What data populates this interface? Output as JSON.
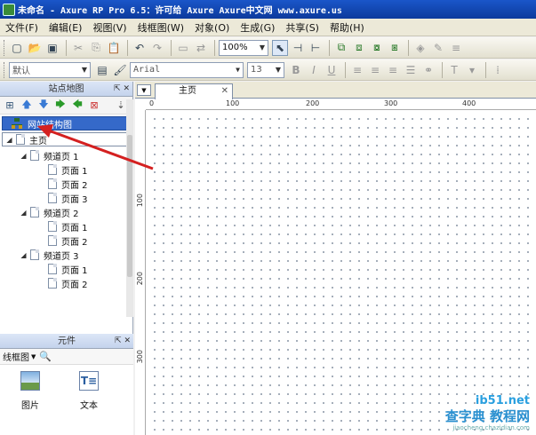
{
  "window": {
    "title": "未命名 - Axure RP Pro 6.5：许可给 Axure Axure中文网 www.axure.us"
  },
  "menu": [
    {
      "label": "文件(F)"
    },
    {
      "label": "编辑(E)"
    },
    {
      "label": "视图(V)"
    },
    {
      "label": "线框图(W)"
    },
    {
      "label": "对象(O)"
    },
    {
      "label": "生成(G)"
    },
    {
      "label": "共享(S)"
    },
    {
      "label": "帮助(H)"
    }
  ],
  "toolbar": {
    "zoom_value": "100%",
    "font_style_value": "默认",
    "font_family_value": "Arial",
    "font_size_value": "13"
  },
  "sitemap": {
    "panel_title": "站点地图",
    "root_item": "网站结构图",
    "home_label": "主页",
    "tree": [
      {
        "label": "频道页 1",
        "children": [
          {
            "label": "页面 1"
          },
          {
            "label": "页面 2"
          },
          {
            "label": "页面 3"
          }
        ]
      },
      {
        "label": "频道页 2",
        "children": [
          {
            "label": "页面 1"
          },
          {
            "label": "页面 2"
          }
        ]
      },
      {
        "label": "频道页 3",
        "children": [
          {
            "label": "页面 1"
          },
          {
            "label": "页面 2"
          }
        ]
      }
    ]
  },
  "widgets": {
    "panel_title": "元件",
    "library_value": "线框图",
    "items": [
      {
        "label": "图片"
      },
      {
        "label": "文本"
      }
    ]
  },
  "canvas": {
    "active_tab": "主页",
    "ruler_top_labels": [
      "0",
      "100",
      "200",
      "300",
      "400"
    ],
    "ruler_left_labels": [
      "100",
      "200",
      "300"
    ]
  },
  "watermark": {
    "url": "ib51.net",
    "text": "查字典 教程网",
    "sub": "jiaocheng.chazidian.com"
  },
  "colors": {
    "titlebar": "#0c3a9c",
    "selection": "#3569c9",
    "annotation_arrow": "#d42020"
  }
}
